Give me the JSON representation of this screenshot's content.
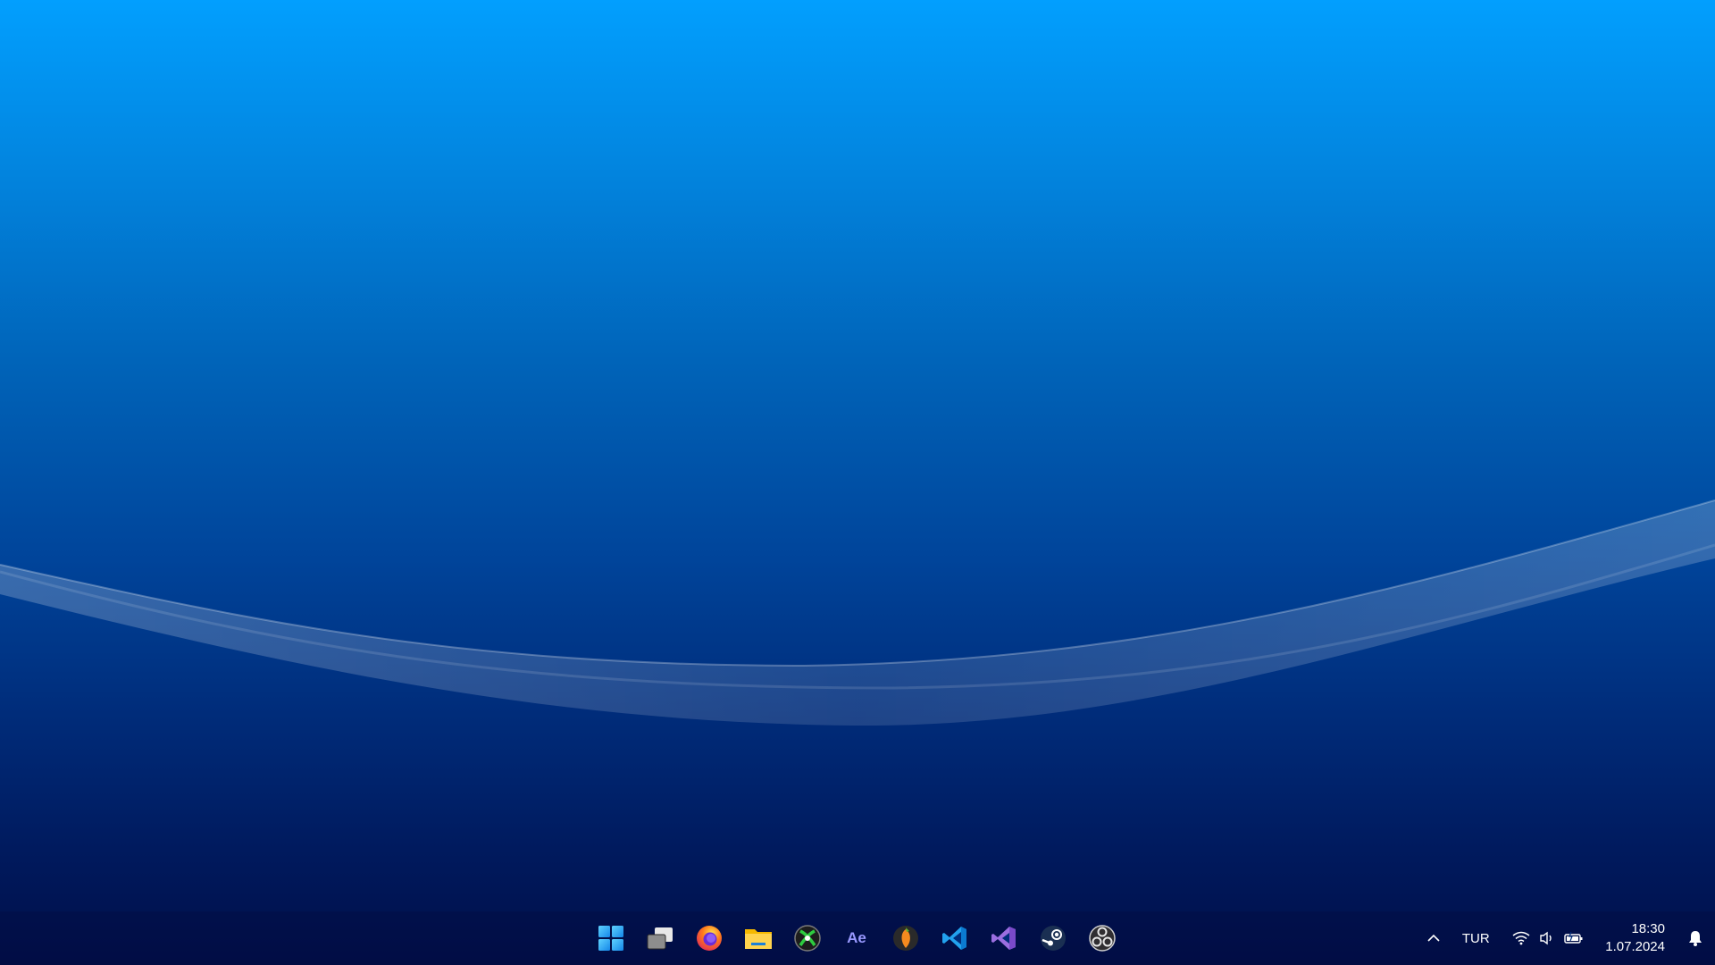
{
  "desktop": {
    "wallpaper": "windows-blue-wave"
  },
  "taskbar": {
    "apps": [
      {
        "name": "start-button",
        "icon": "windows-logo-icon"
      },
      {
        "name": "task-view-button",
        "icon": "task-view-icon"
      },
      {
        "name": "firefox-button",
        "icon": "firefox-icon"
      },
      {
        "name": "file-explorer-button",
        "icon": "folder-icon"
      },
      {
        "name": "xbox-app-button",
        "icon": "xbox-icon"
      },
      {
        "name": "after-effects-button",
        "icon": "after-effects-icon",
        "label": "Ae"
      },
      {
        "name": "fl-studio-button",
        "icon": "fl-studio-icon"
      },
      {
        "name": "vscode-button",
        "icon": "vscode-icon"
      },
      {
        "name": "visual-studio-button",
        "icon": "visual-studio-icon"
      },
      {
        "name": "steam-button",
        "icon": "steam-icon"
      },
      {
        "name": "obs-button",
        "icon": "obs-icon"
      }
    ],
    "tray": {
      "language": "TUR",
      "time": "18:30",
      "date": "1.07.2024"
    }
  },
  "colors": {
    "accent": "#0a9ef5",
    "text": "#ffffff"
  }
}
